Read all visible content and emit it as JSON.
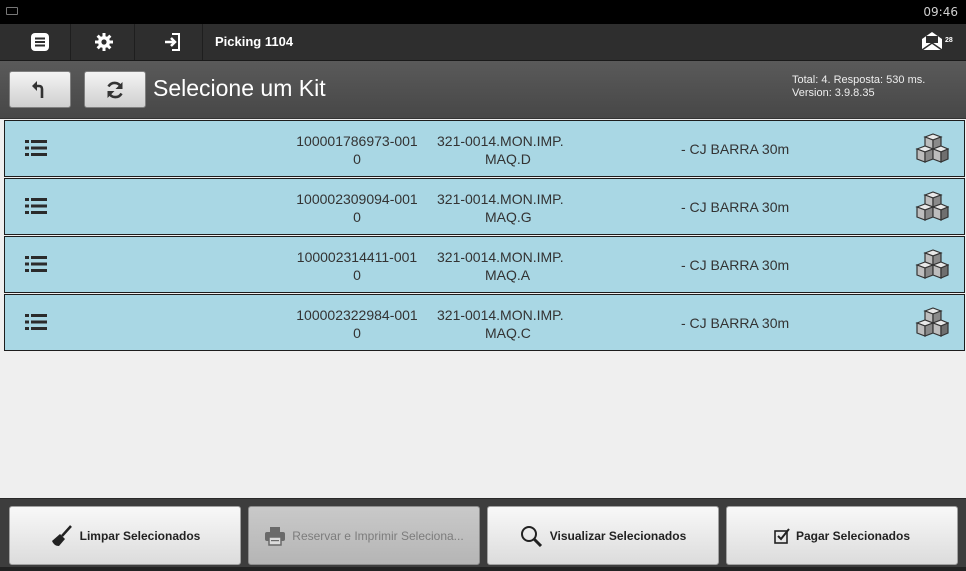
{
  "status_bar": {
    "time": "09:46"
  },
  "toolbar": {
    "title": "Picking 1104",
    "messages_badge": "28",
    "icons": [
      "list-icon",
      "gear-icon",
      "login-icon",
      "mail-icon"
    ]
  },
  "header": {
    "title": "Selecione um Kit",
    "info_line1": "Total: 4. Resposta: 530 ms.",
    "info_line2": "Version: 3.9.8.35",
    "icons": [
      "undo-icon",
      "refresh-icon"
    ]
  },
  "kits": [
    {
      "kit_line1": "100001786973-001",
      "kit_line2": "0",
      "code_line1": "321-0014.MON.IMP.",
      "code_line2": "MAQ.D",
      "desc": "- CJ BARRA 30m"
    },
    {
      "kit_line1": "100002309094-001",
      "kit_line2": "0",
      "code_line1": "321-0014.MON.IMP.",
      "code_line2": "MAQ.G",
      "desc": "- CJ BARRA 30m"
    },
    {
      "kit_line1": "100002314411-001",
      "kit_line2": "0",
      "code_line1": "321-0014.MON.IMP.",
      "code_line2": "MAQ.A",
      "desc": "- CJ BARRA 30m"
    },
    {
      "kit_line1": "100002322984-001",
      "kit_line2": "0",
      "code_line1": "321-0014.MON.IMP.",
      "code_line2": "MAQ.C",
      "desc": "- CJ BARRA 30m"
    }
  ],
  "actions": {
    "clear": "Limpar Selecionados",
    "reserve_print": "Reservar e Imprimir Seleciona...",
    "view": "Visualizar Selecionados",
    "pay": "Pagar Selecionados"
  },
  "colors": {
    "row_bg": "#a9d7e4",
    "toolbar_bg": "#2e2e2e",
    "header_bg": "#4f4f4f"
  }
}
